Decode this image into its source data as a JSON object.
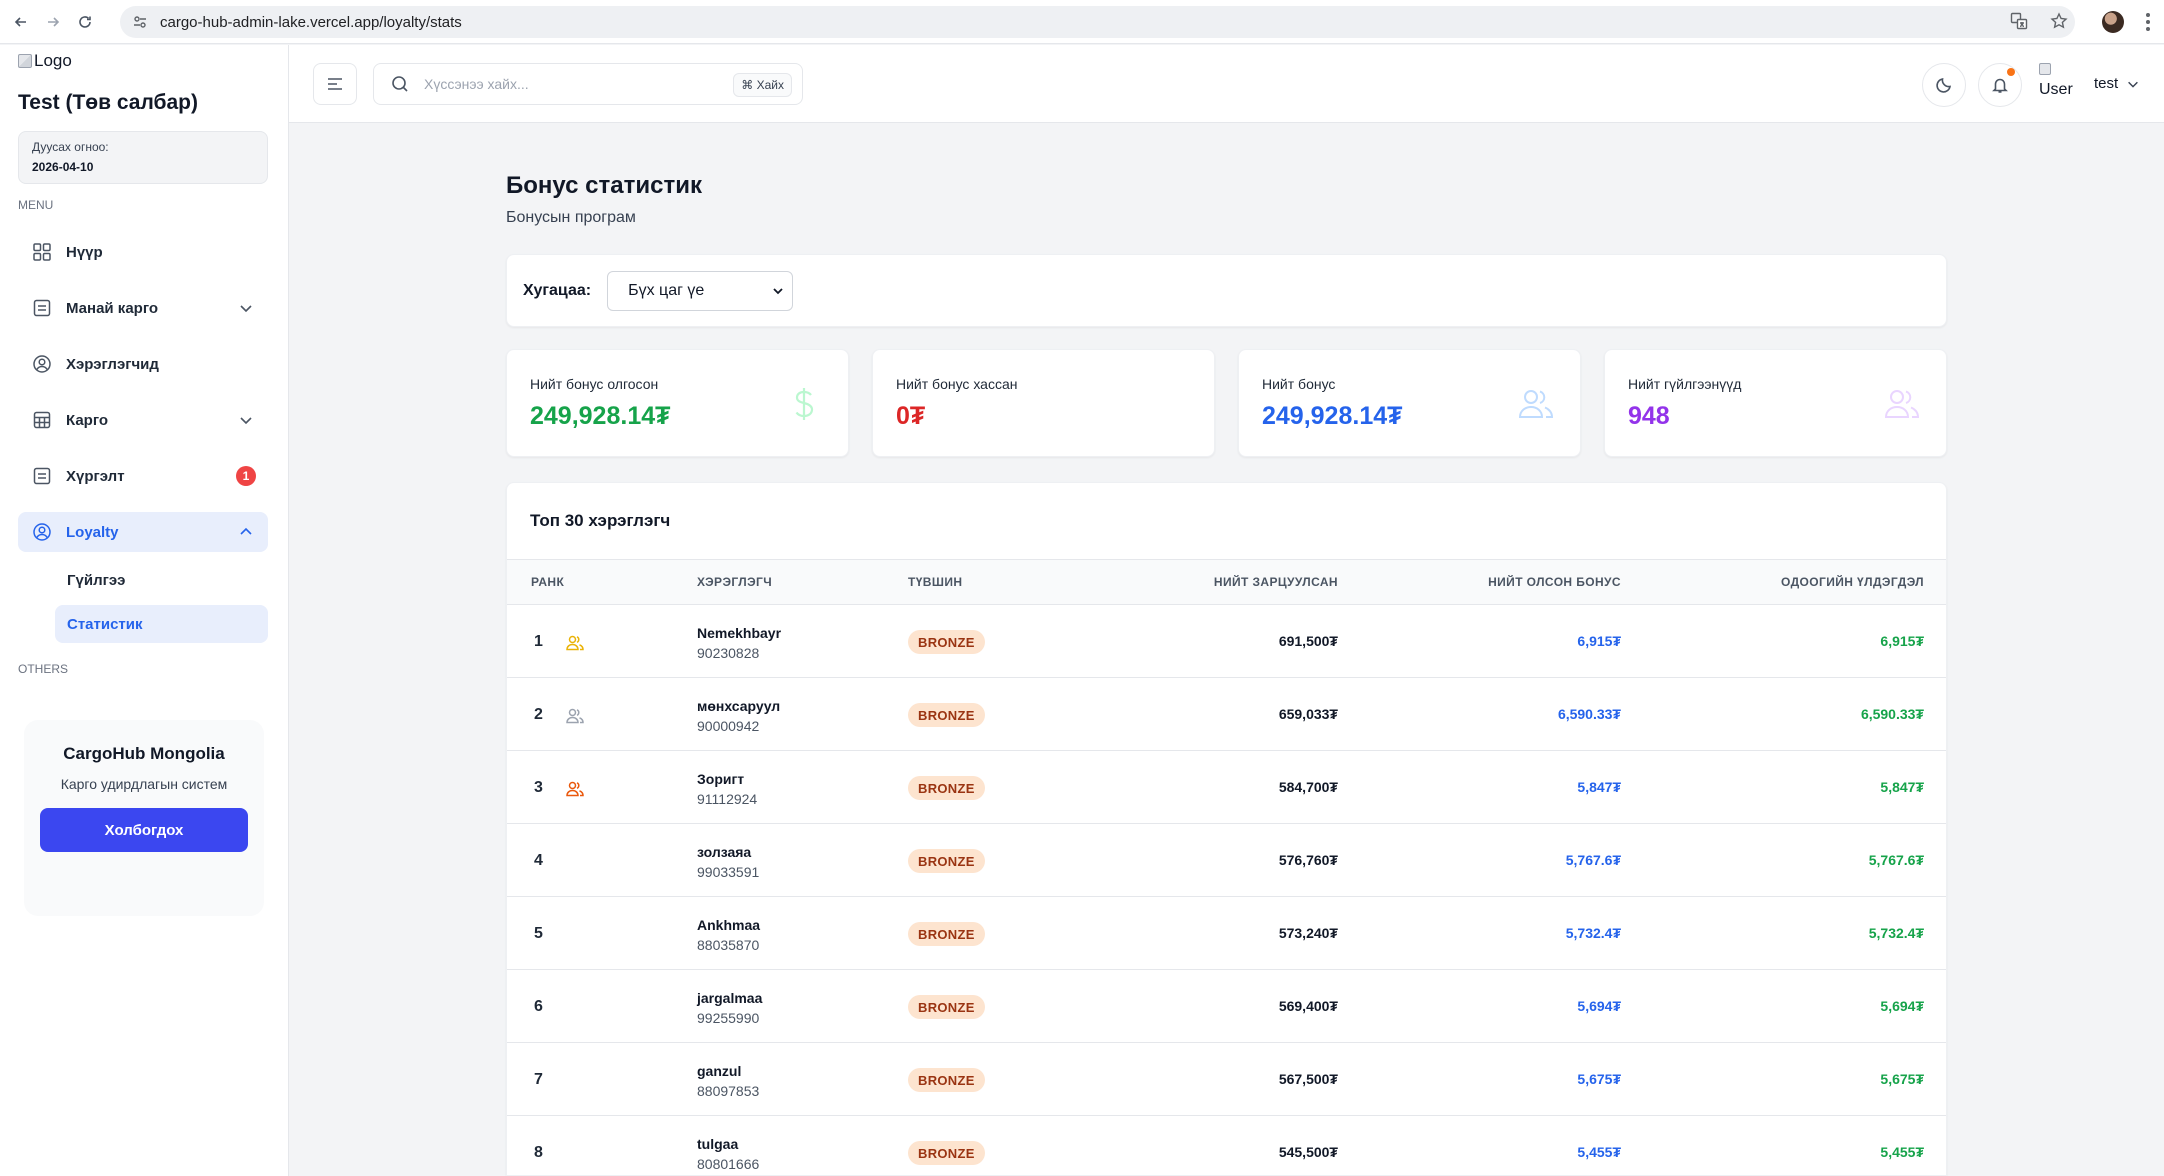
{
  "browser": {
    "url": "cargo-hub-admin-lake.vercel.app/loyalty/stats"
  },
  "sidebar": {
    "logo_alt": "Logo",
    "branch_title": "Test (Төв салбар)",
    "expiry_label": "Дуусах огноо:",
    "expiry_date": "2026-04-10",
    "menu_label": "MENU",
    "others_label": "OTHERS",
    "items": [
      {
        "label": "Нүүр",
        "icon": "grid-icon"
      },
      {
        "label": "Манай карго",
        "icon": "document-icon"
      },
      {
        "label": "Хэрэглэгчид",
        "icon": "user-circle-icon"
      },
      {
        "label": "Карго",
        "icon": "table-icon"
      },
      {
        "label": "Хүргэлт",
        "icon": "document-icon",
        "badge": "1"
      },
      {
        "label": "Loyalty",
        "icon": "user-circle-icon"
      }
    ],
    "sub_items": [
      {
        "label": "Гүйлгээ"
      },
      {
        "label": "Статистик"
      }
    ],
    "promo": {
      "title": "CargoHub Mongolia",
      "subtitle": "Карго удирдлагын систем",
      "button": "Холбогдох"
    }
  },
  "header": {
    "search_placeholder": "Хүссэнээ хайх...",
    "search_shortcut": "⌘ Хайх",
    "user_alt": "User",
    "user_name": "test"
  },
  "page": {
    "title": "Бонус статистик",
    "subtitle": "Бонусын програм",
    "filter_label": "Хугацаа:",
    "filter_value": "Бүх цаг үе"
  },
  "stats": [
    {
      "label": "Нийт бонус олгосон",
      "value": "249,928.14₮",
      "color": "#16a34a",
      "icon": "dollar-icon"
    },
    {
      "label": "Нийт бонус хассан",
      "value": "0₮",
      "color": "#dc2626",
      "icon": ""
    },
    {
      "label": "Нийт бонус",
      "value": "249,928.14₮",
      "color": "#2563eb",
      "icon": "users-icon"
    },
    {
      "label": "Нийт гүйлгээнүүд",
      "value": "948",
      "color": "#9333ea",
      "icon": "users-icon"
    }
  ],
  "table": {
    "title": "Топ 30 хэрэглэгч",
    "columns": [
      "РАНК",
      "ХЭРЭГЛЭГЧ",
      "ТҮВШИН",
      "НИЙТ ЗАРЦУУЛСАН",
      "НИЙТ ОЛСОН БОНУС",
      "ОДООГИЙН ҮЛДЭГДЭЛ"
    ],
    "rows": [
      {
        "rank": "1",
        "name": "Nemekhbayr",
        "phone": "90230828",
        "tier": "BRONZE",
        "spent": "691,500₮",
        "earned": "6,915₮",
        "balance": "6,915₮",
        "medal_color": "#eab308"
      },
      {
        "rank": "2",
        "name": "мөнхсаруул",
        "phone": "90000942",
        "tier": "BRONZE",
        "spent": "659,033₮",
        "earned": "6,590.33₮",
        "balance": "6,590.33₮",
        "medal_color": "#9ca3af"
      },
      {
        "rank": "3",
        "name": "Зоригт",
        "phone": "91112924",
        "tier": "BRONZE",
        "spent": "584,700₮",
        "earned": "5,847₮",
        "balance": "5,847₮",
        "medal_color": "#ea580c"
      },
      {
        "rank": "4",
        "name": "золзаяа",
        "phone": "99033591",
        "tier": "BRONZE",
        "spent": "576,760₮",
        "earned": "5,767.6₮",
        "balance": "5,767.6₮"
      },
      {
        "rank": "5",
        "name": "Ankhmaa",
        "phone": "88035870",
        "tier": "BRONZE",
        "spent": "573,240₮",
        "earned": "5,732.4₮",
        "balance": "5,732.4₮"
      },
      {
        "rank": "6",
        "name": "jargalmaa",
        "phone": "99255990",
        "tier": "BRONZE",
        "spent": "569,400₮",
        "earned": "5,694₮",
        "balance": "5,694₮"
      },
      {
        "rank": "7",
        "name": "ganzul",
        "phone": "88097853",
        "tier": "BRONZE",
        "spent": "567,500₮",
        "earned": "5,675₮",
        "balance": "5,675₮"
      },
      {
        "rank": "8",
        "name": "tulgaa",
        "phone": "80801666",
        "tier": "BRONZE",
        "spent": "545,500₮",
        "earned": "5,455₮",
        "balance": "5,455₮"
      }
    ]
  }
}
